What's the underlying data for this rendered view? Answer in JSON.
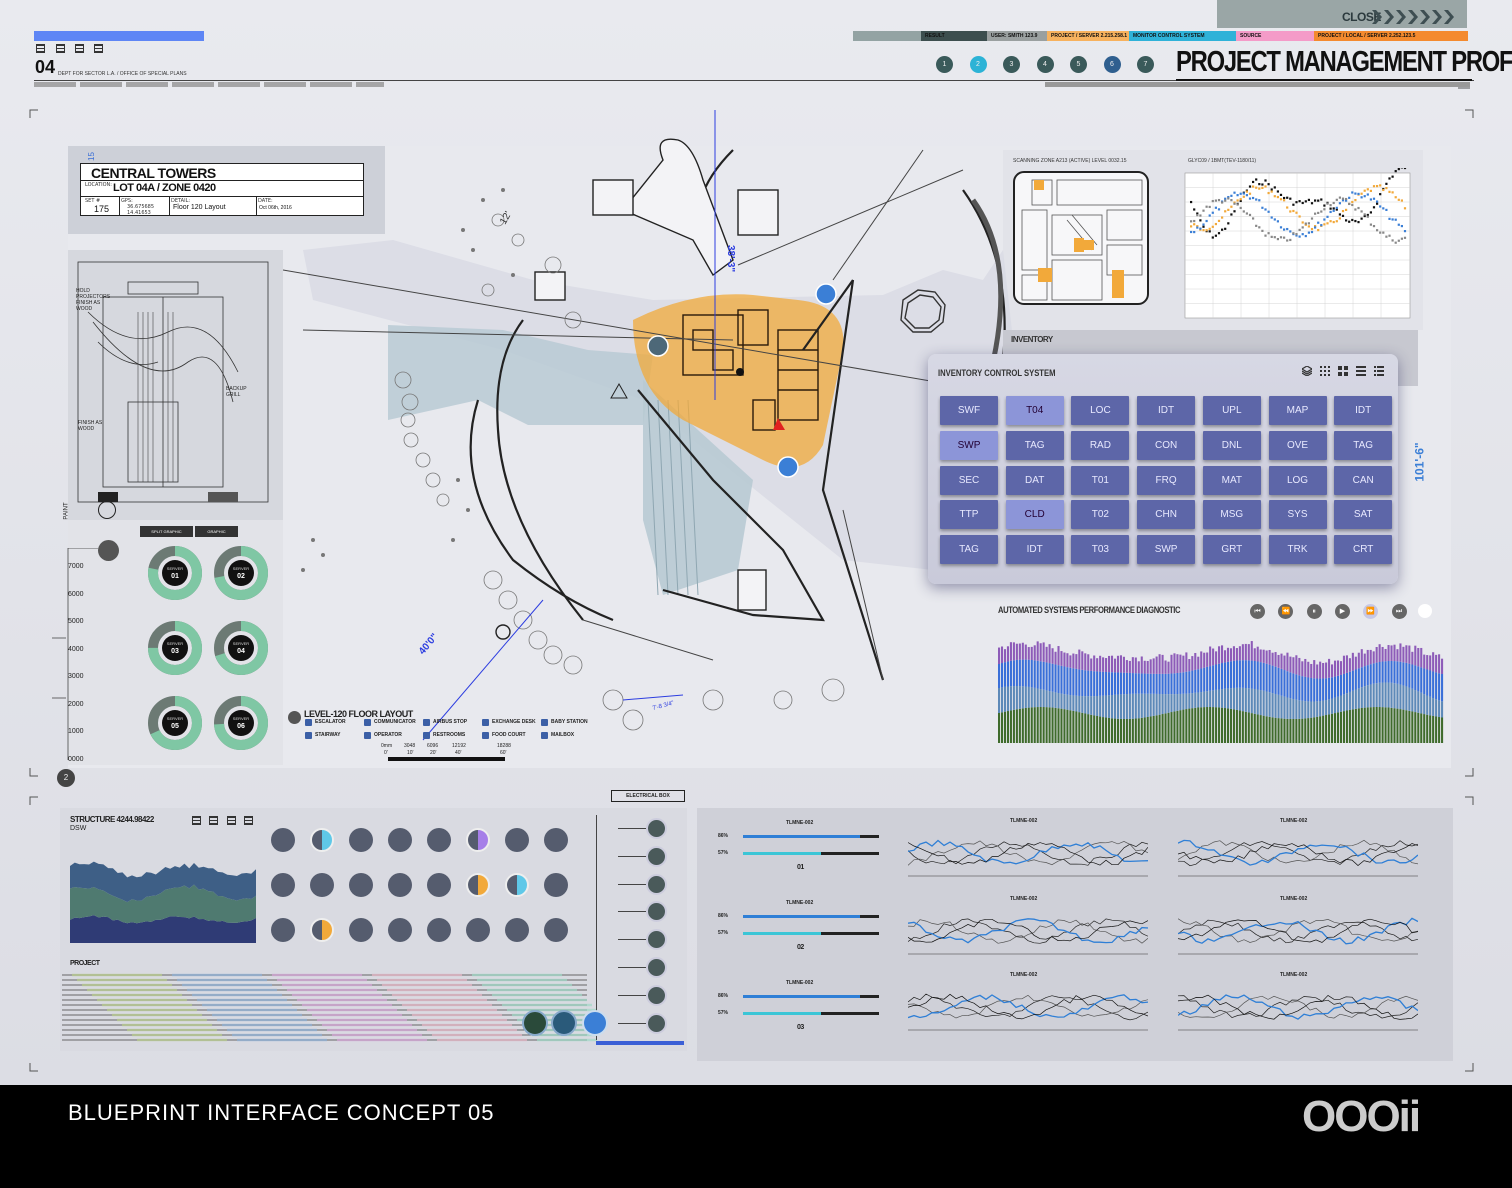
{
  "header": {
    "close_label": "CLOSE",
    "title": "PROJECT MANAGEMENT PROFILE",
    "doc_number": "04",
    "doc_path": "DEPT FOR SECTOR L.A. / OFFICE OF SPECIAL PLANS",
    "status_segments": [
      {
        "label": "",
        "color": "#93a3a3"
      },
      {
        "label": "RESULT",
        "color": "#3c4e4e"
      },
      {
        "label": "USER: SMITH 123.9",
        "color": "#9aa0a0"
      },
      {
        "label": "PROJECT / SERVER 2.215.258.1",
        "color": "#f7b25e"
      },
      {
        "label": "MONITOR CONTROL SYSTEM",
        "color": "#2fb2d8"
      },
      {
        "label": "SOURCE",
        "color": "#f49bc8"
      },
      {
        "label": "PROJECT / LOCAL / SERVER 2.252.123.5",
        "color": "#f48a2e"
      }
    ],
    "steps": [
      {
        "num": "1",
        "color": "#3a5a5a"
      },
      {
        "num": "2",
        "color": "#2cb3d6"
      },
      {
        "num": "3",
        "color": "#3a5a5a"
      },
      {
        "num": "4",
        "color": "#3a5a5a"
      },
      {
        "num": "5",
        "color": "#3a5a5a"
      },
      {
        "num": "6",
        "color": "#2f5f8f"
      },
      {
        "num": "7",
        "color": "#3a5a5a"
      }
    ]
  },
  "title_block": {
    "name": "CENTRAL TOWERS",
    "location_label": "LOCATION:",
    "location": "LOT 04A / ZONE 0420",
    "set_label": "SET #",
    "set_value": "175",
    "gps_label": "GPS:",
    "gps_values": [
      "36.675685",
      "14.41653"
    ],
    "detail_label": "DETAIL:",
    "detail": "Floor 120 Layout",
    "date_label": "DATE:",
    "date": "Oct 06th, 2016",
    "sheet_no": "15"
  },
  "plan": {
    "dims": [
      "38'-3\"",
      "40'0\"",
      "12'",
      "101'-6\"",
      "7'-8 3/4\""
    ],
    "legend_title": "LEVEL-120 FLOOR LAYOUT",
    "legend_items": [
      "ESCALATOR",
      "STAIRWAY",
      "COMMUNICATOR",
      "OPERATOR",
      "AIRBUS STOP",
      "RESTROOMS",
      "EXCHANGE DESK",
      "FOOD COURT",
      "BABY STATION",
      "MAILBOX"
    ],
    "scale_labels": [
      "0mm",
      "3048",
      "6096",
      "12192",
      "18288"
    ],
    "scale_feet": [
      "0'",
      "10'",
      "20'",
      "40'",
      "60'"
    ]
  },
  "left_panel": {
    "callouts": [
      "HOLD PROJECTORS FINISH AS WOOD",
      "BACKUP GRILL",
      "FINISH AS WOOD"
    ],
    "side_label": "PAINT",
    "tabs": [
      "SPLIT GRAPHIC",
      "GRAPHIC"
    ],
    "scale_values": [
      "7000",
      "6000",
      "5000",
      "4000",
      "3000",
      "2000",
      "1000",
      "0000"
    ],
    "servers": [
      {
        "label": "SERVER",
        "num": "01",
        "share": 0.78
      },
      {
        "label": "SERVER",
        "num": "02",
        "share": 0.72
      },
      {
        "label": "SERVER",
        "num": "03",
        "share": 0.75
      },
      {
        "label": "SERVER",
        "num": "04",
        "share": 0.7
      },
      {
        "label": "SERVER",
        "num": "05",
        "share": 0.68
      },
      {
        "label": "SERVER",
        "num": "06",
        "share": 0.74
      }
    ],
    "page_badge": "2"
  },
  "scan_panel": {
    "scan_title": "SCANNING ZONE A213 (ACTIVE)  LEVEL 0032.15",
    "chart_title": "GLYC09 / 1BMT(TEV-1180/11)"
  },
  "inventory": {
    "label": "INVENTORY",
    "title": "INVENTORY CONTROL SYSTEM",
    "rows": [
      [
        "SWF",
        "T04",
        "LOC",
        "IDT",
        "UPL",
        "MAP",
        "IDT"
      ],
      [
        "SWP",
        "TAG",
        "RAD",
        "CON",
        "DNL",
        "OVE",
        "TAG"
      ],
      [
        "SEC",
        "DAT",
        "T01",
        "FRQ",
        "MAT",
        "LOG",
        "CAN"
      ],
      [
        "TTP",
        "CLD",
        "T02",
        "CHN",
        "MSG",
        "SYS",
        "SAT"
      ],
      [
        "TAG",
        "IDT",
        "T03",
        "SWP",
        "GRT",
        "TRK",
        "CRT"
      ]
    ],
    "active": [
      "0-1",
      "1-0",
      "3-1"
    ]
  },
  "diagnostic": {
    "title": "AUTOMATED SYSTEMS PERFORMANCE DIAGNOSTIC",
    "controls": [
      "skip-back-icon",
      "rewind-icon",
      "pause-icon",
      "play-icon",
      "fast-forward-icon",
      "skip-forward-icon"
    ]
  },
  "bottom_left": {
    "structure_title": "STRUCTURE 4244.98422",
    "structure_sub": "DSW",
    "project_label": "PROJECT",
    "electrical_box": "ELECTRICAL BOX"
  },
  "trend_panel": {
    "groups": [
      {
        "id": "01",
        "title": "TLMNE-002",
        "bar1_label": "86%",
        "bar1": 0.86,
        "bar2_label": "57%",
        "bar2": 0.57
      },
      {
        "id": "02",
        "title": "TLMNE-002",
        "bar1_label": "86%",
        "bar1": 0.86,
        "bar2_label": "57%",
        "bar2": 0.57
      },
      {
        "id": "03",
        "title": "TLMNE-002",
        "bar1_label": "86%",
        "bar1": 0.86,
        "bar2_label": "57%",
        "bar2": 0.57
      }
    ],
    "chart_titles": [
      "TLMNE-002",
      "TLMNE-002",
      "TLMNE-002",
      "TLMNE-002",
      "TLMNE-002",
      "TLMNE-002"
    ]
  },
  "footer": {
    "title": "BLUEPRINT INTERFACE CONCEPT 05",
    "logo": "OOOii"
  },
  "colors": {
    "accent_orange": "#f2a93a",
    "accent_blue": "#3b7fd6",
    "button_purple": "#5d66a8",
    "teal": "#7fc7a4"
  }
}
